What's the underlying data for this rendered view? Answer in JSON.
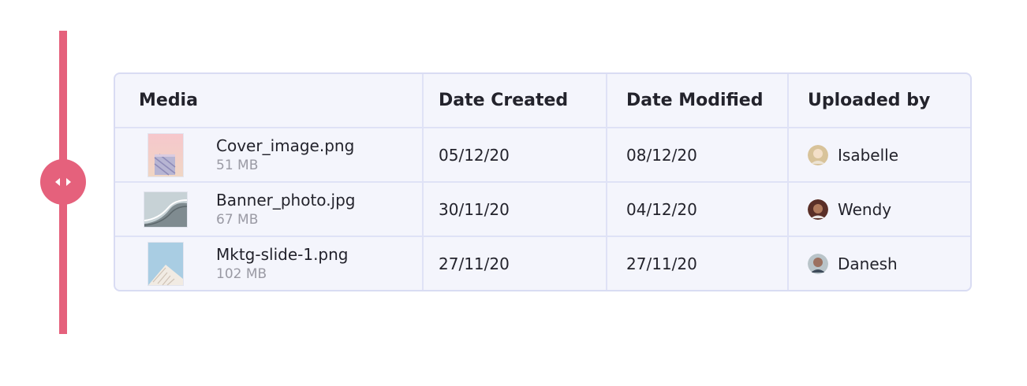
{
  "colors": {
    "accent": "#e5617c",
    "border": "#d9dcf3",
    "table_bg": "#f4f5fc"
  },
  "resize_handle": {
    "icon": "resize-horizontal-icon"
  },
  "table": {
    "headers": {
      "media": "Media",
      "created": "Date Created",
      "modified": "Date Modified",
      "uploader": "Uploaded by"
    },
    "rows": [
      {
        "file_name": "Cover_image.png",
        "file_size": "51 MB",
        "date_created": "05/12/20",
        "date_modified": "08/12/20",
        "uploader": "Isabelle",
        "thumbnail": "pastel-building-image",
        "avatar": "isabelle-avatar"
      },
      {
        "file_name": "Banner_photo.jpg",
        "file_size": "67 MB",
        "date_created": "30/11/20",
        "date_modified": "04/12/20",
        "uploader": "Wendy",
        "thumbnail": "curved-architecture-image",
        "avatar": "wendy-avatar"
      },
      {
        "file_name": "Mktg-slide-1.png",
        "file_size": "102 MB",
        "date_created": "27/11/20",
        "date_modified": "27/11/20",
        "uploader": "Danesh",
        "thumbnail": "sky-building-image",
        "avatar": "danesh-avatar"
      }
    ]
  }
}
